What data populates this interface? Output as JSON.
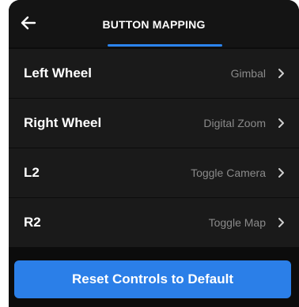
{
  "header": {
    "title": "BUTTON MAPPING",
    "back_icon": "arrow-left-icon",
    "accent_color": "#2b84ef"
  },
  "mappings": [
    {
      "label": "Left Wheel",
      "value": "Gimbal"
    },
    {
      "label": "Right Wheel",
      "value": "Digital Zoom"
    },
    {
      "label": "L2",
      "value": "Toggle Camera"
    },
    {
      "label": "R2",
      "value": "Toggle Map"
    }
  ],
  "reset_button": {
    "label": "Reset Controls to Default",
    "color": "#2b7fe8"
  }
}
